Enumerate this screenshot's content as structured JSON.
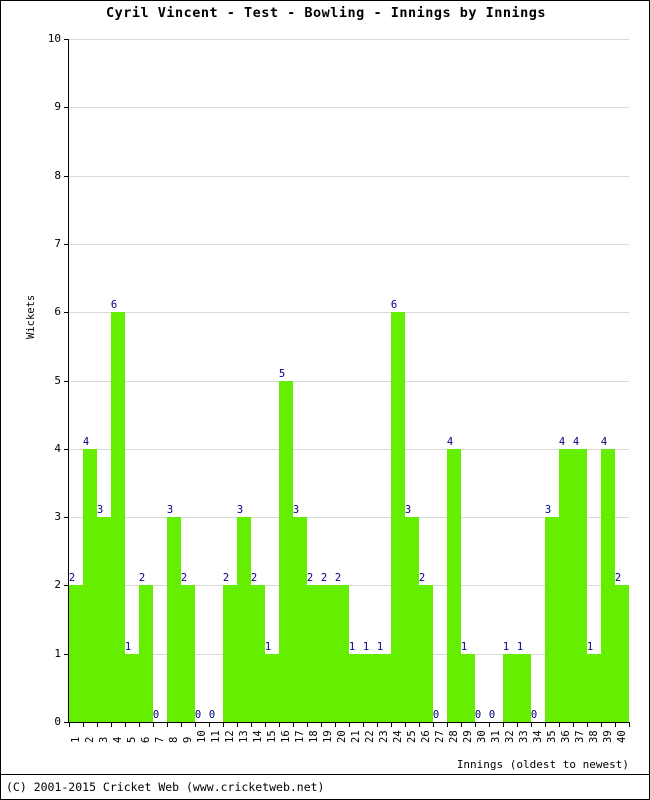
{
  "chart_data": {
    "type": "bar",
    "title": "Cyril Vincent - Test - Bowling - Innings by Innings",
    "xlabel": "Innings (oldest to newest)",
    "ylabel": "Wickets",
    "ylim": [
      0,
      10
    ],
    "ytick_labels": [
      "0",
      "1",
      "2",
      "3",
      "4",
      "5",
      "6",
      "7",
      "8",
      "9",
      "10"
    ],
    "grid": true,
    "legend": "none",
    "bar_color": "#66ee00",
    "label_color": "#000080",
    "categories": [
      "1",
      "2",
      "3",
      "4",
      "5",
      "6",
      "7",
      "8",
      "9",
      "10",
      "11",
      "12",
      "13",
      "14",
      "15",
      "16",
      "17",
      "18",
      "19",
      "20",
      "21",
      "22",
      "23",
      "24",
      "25",
      "26",
      "27",
      "28",
      "29",
      "30",
      "31",
      "32",
      "33",
      "34",
      "35",
      "36",
      "37",
      "38",
      "39",
      "40"
    ],
    "values": [
      2,
      4,
      3,
      6,
      1,
      2,
      0,
      3,
      2,
      0,
      0,
      2,
      3,
      2,
      1,
      5,
      3,
      2,
      2,
      2,
      1,
      1,
      1,
      6,
      3,
      2,
      0,
      4,
      1,
      0,
      0,
      1,
      1,
      0,
      3,
      4,
      4,
      1,
      4,
      2
    ],
    "data_labels": [
      "2",
      "4",
      "3",
      "6",
      "1",
      "2",
      "0",
      "3",
      "2",
      "0",
      "0",
      "2",
      "3",
      "2",
      "1",
      "5",
      "3",
      "2",
      "2",
      "2",
      "1",
      "1",
      "1",
      "6",
      "3",
      "2",
      "0",
      "4",
      "1",
      "0",
      "0",
      "1",
      "1",
      "0",
      "3",
      "4",
      "4",
      "1",
      "4",
      "2"
    ]
  },
  "footer": {
    "copyright": "(C) 2001-2015 Cricket Web (www.cricketweb.net)"
  }
}
